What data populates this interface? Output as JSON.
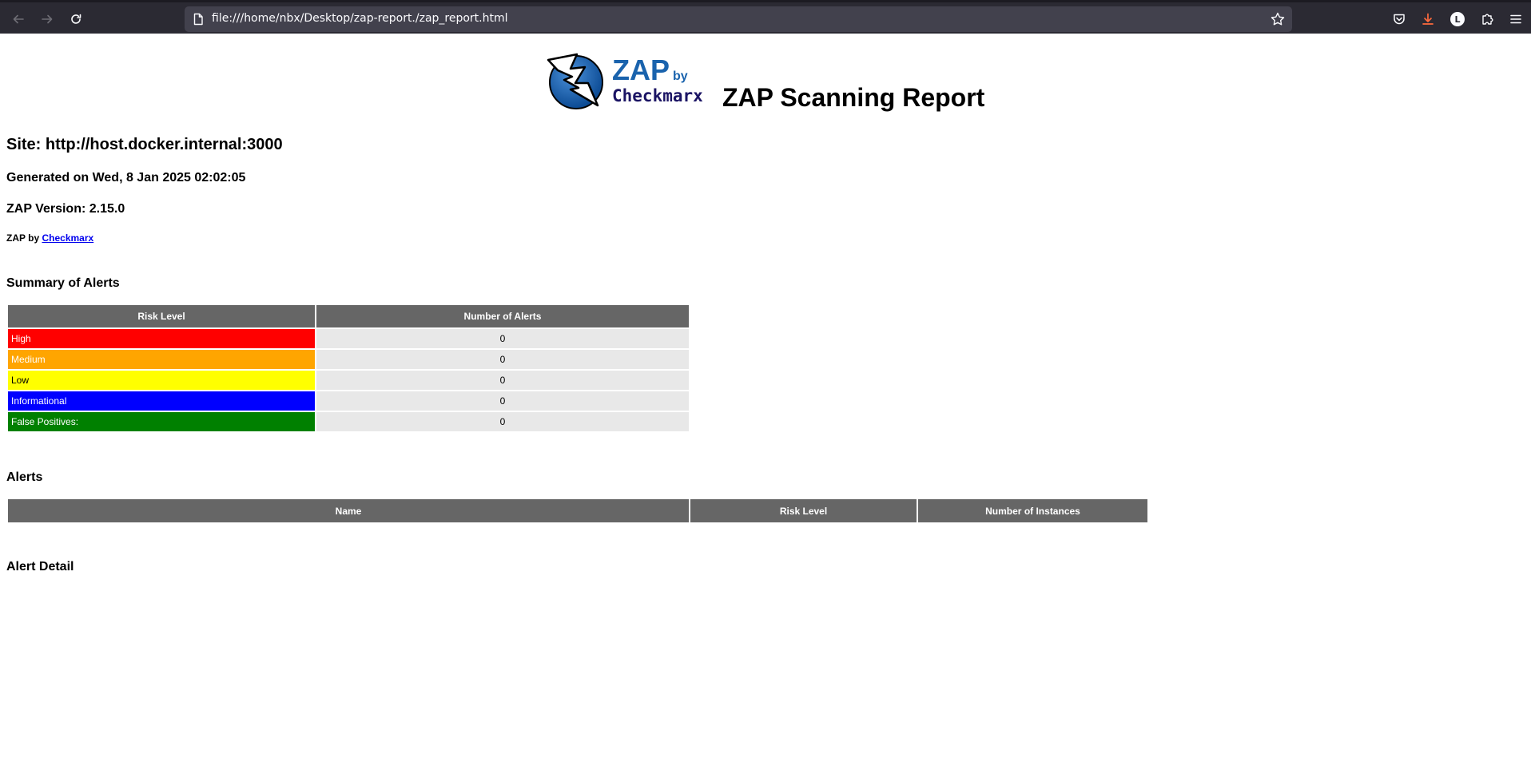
{
  "browser": {
    "url": "file:///home/nbx/Desktop/zap-report./zap_report.html",
    "profile_initial": "L"
  },
  "report": {
    "logo": {
      "wordmark": "ZAP",
      "by": "by",
      "brand": "Checkmarx"
    },
    "title": "ZAP Scanning Report",
    "site": "Site: http://host.docker.internal:3000",
    "generated": "Generated on Wed, 8 Jan 2025 02:02:05",
    "version": "ZAP Version: 2.15.0",
    "byline_prefix": "ZAP by",
    "byline_link": "Checkmarx"
  },
  "summary": {
    "heading": "Summary of Alerts",
    "col_risk": "Risk Level",
    "col_count": "Number of Alerts",
    "rows": [
      {
        "label": "High",
        "count": "0",
        "color": "#ff0000"
      },
      {
        "label": "Medium",
        "count": "0",
        "color": "#ffa500"
      },
      {
        "label": "Low",
        "count": "0",
        "color": "#ffff00"
      },
      {
        "label": "Informational",
        "count": "0",
        "color": "#0000ff"
      },
      {
        "label": "False Positives:",
        "count": "0",
        "color": "#008000"
      }
    ]
  },
  "alerts": {
    "heading": "Alerts",
    "col_name": "Name",
    "col_risk": "Risk Level",
    "col_instances": "Number of Instances"
  },
  "alert_detail": {
    "heading": "Alert Detail"
  }
}
